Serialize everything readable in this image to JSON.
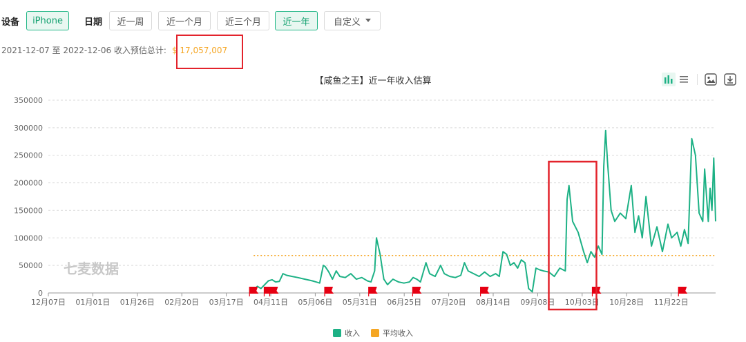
{
  "filters": {
    "device_label": "设备",
    "device_value": "iPhone",
    "date_label": "日期",
    "date_options": [
      "近一周",
      "近一个月",
      "近三个月",
      "近一年"
    ],
    "date_selected": "近一年",
    "custom_label": "自定义"
  },
  "summary": {
    "range_text": "2021-12-07 至 2022-12-06 收入预估总计:",
    "total": "$ 17,057,007"
  },
  "watermark": "七麦数据",
  "icons": [
    "bar-chart-icon",
    "list-icon",
    "image-download-icon",
    "download-icon"
  ],
  "colors": {
    "revenue": "#1db185",
    "average": "#f5a623",
    "highlight_box": "#e3232c",
    "flag": "#e60012",
    "active_bg": "#e8f7f1"
  },
  "chart_data": {
    "type": "line",
    "title": "【咸鱼之王】近一年收入估算",
    "x_start": "2021-12-07",
    "x_end": "2022-12-06",
    "x_ticks": [
      "12月07日",
      "01月01日",
      "01月26日",
      "02月20日",
      "03月17日",
      "04月11日",
      "05月06日",
      "05月31日",
      "06月25日",
      "07月20日",
      "08月14日",
      "09月08日",
      "10月03日",
      "10月28日",
      "11月22日"
    ],
    "ylim": [
      0,
      350000
    ],
    "y_ticks": [
      0,
      50000,
      100000,
      150000,
      200000,
      250000,
      300000,
      350000
    ],
    "grid": true,
    "legend_position": "bottom",
    "series": [
      {
        "name": "收入",
        "points": [
          [
            "2022-03-29",
            5000
          ],
          [
            "2022-03-31",
            12000
          ],
          [
            "2022-04-02",
            8000
          ],
          [
            "2022-04-04",
            15000
          ],
          [
            "2022-04-06",
            22000
          ],
          [
            "2022-04-08",
            24000
          ],
          [
            "2022-04-10",
            20000
          ],
          [
            "2022-04-12",
            21000
          ],
          [
            "2022-04-14",
            35000
          ],
          [
            "2022-04-16",
            32000
          ],
          [
            "2022-04-19",
            30000
          ],
          [
            "2022-04-22",
            28000
          ],
          [
            "2022-04-26",
            25000
          ],
          [
            "2022-04-30",
            22000
          ],
          [
            "2022-05-02",
            20000
          ],
          [
            "2022-05-04",
            18000
          ],
          [
            "2022-05-06",
            50000
          ],
          [
            "2022-05-07",
            48000
          ],
          [
            "2022-05-09",
            38000
          ],
          [
            "2022-05-11",
            25000
          ],
          [
            "2022-05-13",
            40000
          ],
          [
            "2022-05-15",
            30000
          ],
          [
            "2022-05-18",
            28000
          ],
          [
            "2022-05-21",
            35000
          ],
          [
            "2022-05-24",
            25000
          ],
          [
            "2022-05-27",
            28000
          ],
          [
            "2022-05-30",
            22000
          ],
          [
            "2022-06-01",
            20000
          ],
          [
            "2022-06-03",
            40000
          ],
          [
            "2022-06-04",
            100000
          ],
          [
            "2022-06-06",
            70000
          ],
          [
            "2022-06-08",
            25000
          ],
          [
            "2022-06-10",
            15000
          ],
          [
            "2022-06-13",
            25000
          ],
          [
            "2022-06-16",
            20000
          ],
          [
            "2022-06-19",
            18000
          ],
          [
            "2022-06-22",
            20000
          ],
          [
            "2022-06-24",
            28000
          ],
          [
            "2022-06-26",
            25000
          ],
          [
            "2022-06-28",
            20000
          ],
          [
            "2022-07-01",
            55000
          ],
          [
            "2022-07-03",
            35000
          ],
          [
            "2022-07-06",
            30000
          ],
          [
            "2022-07-09",
            50000
          ],
          [
            "2022-07-11",
            35000
          ],
          [
            "2022-07-14",
            30000
          ],
          [
            "2022-07-17",
            28000
          ],
          [
            "2022-07-20",
            32000
          ],
          [
            "2022-07-22",
            55000
          ],
          [
            "2022-07-24",
            40000
          ],
          [
            "2022-07-27",
            35000
          ],
          [
            "2022-07-30",
            30000
          ],
          [
            "2022-08-02",
            38000
          ],
          [
            "2022-08-05",
            30000
          ],
          [
            "2022-08-08",
            35000
          ],
          [
            "2022-08-10",
            30000
          ],
          [
            "2022-08-12",
            75000
          ],
          [
            "2022-08-14",
            70000
          ],
          [
            "2022-08-16",
            50000
          ],
          [
            "2022-08-18",
            55000
          ],
          [
            "2022-08-20",
            45000
          ],
          [
            "2022-08-22",
            60000
          ],
          [
            "2022-08-24",
            55000
          ],
          [
            "2022-08-26",
            8000
          ],
          [
            "2022-08-28",
            2000
          ],
          [
            "2022-08-30",
            45000
          ],
          [
            "2022-09-01",
            42000
          ],
          [
            "2022-09-03",
            40000
          ],
          [
            "2022-09-06",
            38000
          ],
          [
            "2022-09-09",
            30000
          ],
          [
            "2022-09-12",
            45000
          ],
          [
            "2022-09-15",
            40000
          ],
          [
            "2022-09-16",
            170000
          ],
          [
            "2022-09-17",
            195000
          ],
          [
            "2022-09-19",
            130000
          ],
          [
            "2022-09-22",
            110000
          ],
          [
            "2022-09-25",
            75000
          ],
          [
            "2022-09-27",
            55000
          ],
          [
            "2022-09-29",
            75000
          ],
          [
            "2022-10-01",
            65000
          ],
          [
            "2022-10-03",
            85000
          ],
          [
            "2022-10-05",
            70000
          ],
          [
            "2022-10-06",
            230000
          ],
          [
            "2022-10-07",
            295000
          ],
          [
            "2022-10-08",
            240000
          ],
          [
            "2022-10-10",
            150000
          ],
          [
            "2022-10-12",
            130000
          ],
          [
            "2022-10-15",
            145000
          ],
          [
            "2022-10-18",
            135000
          ],
          [
            "2022-10-21",
            195000
          ],
          [
            "2022-10-23",
            110000
          ],
          [
            "2022-10-25",
            140000
          ],
          [
            "2022-10-27",
            100000
          ],
          [
            "2022-10-29",
            175000
          ],
          [
            "2022-11-01",
            85000
          ],
          [
            "2022-11-04",
            120000
          ],
          [
            "2022-11-07",
            75000
          ],
          [
            "2022-11-10",
            125000
          ],
          [
            "2022-11-12",
            100000
          ],
          [
            "2022-11-15",
            110000
          ],
          [
            "2022-11-17",
            85000
          ],
          [
            "2022-11-19",
            115000
          ],
          [
            "2022-11-21",
            90000
          ],
          [
            "2022-11-23",
            280000
          ],
          [
            "2022-11-25",
            250000
          ],
          [
            "2022-11-27",
            145000
          ],
          [
            "2022-11-29",
            130000
          ],
          [
            "2022-11-30",
            225000
          ],
          [
            "2022-12-02",
            130000
          ],
          [
            "2022-12-03",
            190000
          ],
          [
            "2022-12-04",
            150000
          ],
          [
            "2022-12-05",
            245000
          ],
          [
            "2022-12-06",
            130000
          ]
        ]
      },
      {
        "name": "平均收入",
        "style": "dotted",
        "points": [
          [
            "2022-03-29",
            68000
          ],
          [
            "2022-12-06",
            68000
          ]
        ]
      }
    ],
    "event_markers": [
      "2022-03-29",
      "2022-04-06",
      "2022-04-09",
      "2022-05-09",
      "2022-06-02",
      "2022-06-26",
      "2022-08-02",
      "2022-10-02",
      "2022-11-18"
    ],
    "highlight_range": [
      "2022-09-06",
      "2022-10-02"
    ]
  }
}
